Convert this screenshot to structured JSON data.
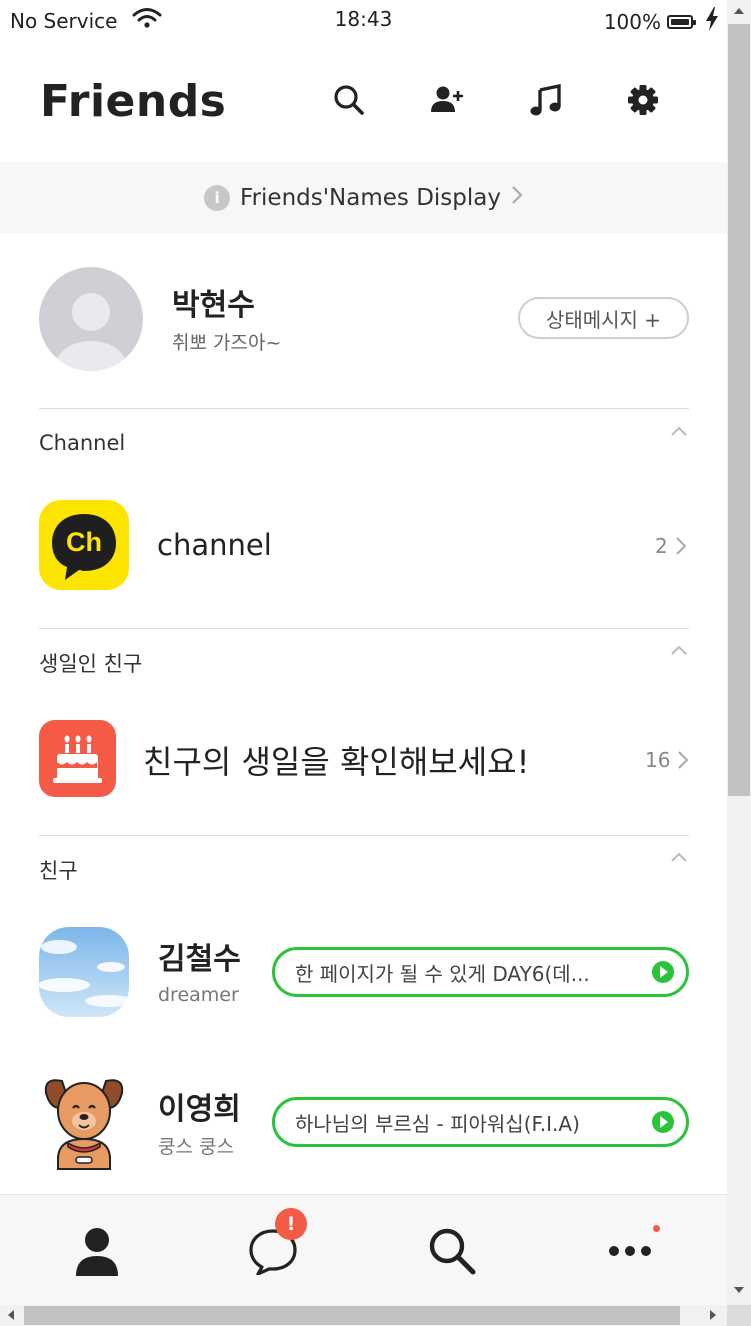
{
  "status_bar": {
    "carrier": "No Service",
    "time": "18:43",
    "battery": "100%"
  },
  "header": {
    "title": "Friends",
    "icons": [
      "search-icon",
      "add-friend-icon",
      "music-icon",
      "settings-icon"
    ]
  },
  "banner": {
    "info_glyph": "i",
    "text": "Friends'Names Display"
  },
  "profile": {
    "name": "박현수",
    "status_message": "취뽀 가즈아~",
    "status_button": "상태메시지 +"
  },
  "sections": {
    "channel": {
      "title": "Channel",
      "item_icon_text": "Ch",
      "item_label": "channel",
      "count": "2"
    },
    "birthday": {
      "title": "생일인 친구",
      "item_label": "친구의 생일을 확인해보세요!",
      "count": "16"
    },
    "friends": {
      "title": "친구",
      "items": [
        {
          "name": "김철수",
          "sub": "dreamer",
          "music": "한 페이지가 될 수 있게 DAY6(데..."
        },
        {
          "name": "이영희",
          "sub": "쿵스 쿵스",
          "music": "하나님의 부르심 - 피아워십(F.I.A)"
        }
      ]
    }
  },
  "tabbar": {
    "tabs": [
      "friends-tab",
      "chats-tab",
      "search-tab",
      "more-tab"
    ],
    "chat_badge": "!"
  },
  "colors": {
    "accent_green": "#2bc33b",
    "channel_yellow": "#fee500",
    "birthday_red": "#f45a45",
    "badge_red": "#f45a45"
  }
}
